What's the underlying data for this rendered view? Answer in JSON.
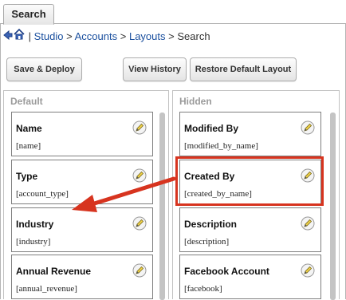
{
  "tabs": [
    {
      "label": "Search"
    }
  ],
  "breadcrumb": {
    "studio": "Studio",
    "accounts": "Accounts",
    "layouts": "Layouts",
    "current": "Search",
    "separator": ">"
  },
  "toolbar": {
    "save_deploy": "Save & Deploy",
    "view_history": "View History",
    "restore_default": "Restore Default Layout"
  },
  "default_panel": {
    "title": "Default",
    "fields": [
      {
        "name": "Name",
        "key": "[name]"
      },
      {
        "name": "Type",
        "key": "[account_type]"
      },
      {
        "name": "Industry",
        "key": "[industry]"
      },
      {
        "name": "Annual Revenue",
        "key": "[annual_revenue]"
      }
    ]
  },
  "hidden_panel": {
    "title": "Hidden",
    "fields": [
      {
        "name": "Modified By",
        "key": "[modified_by_name]"
      },
      {
        "name": "Created By",
        "key": "[created_by_name]"
      },
      {
        "name": "Description",
        "key": "[description]"
      },
      {
        "name": "Facebook Account",
        "key": "[facebook]"
      }
    ]
  },
  "icons": {
    "back": "back-arrow-icon",
    "home": "home-icon",
    "edit": "pencil-icon"
  },
  "colors": {
    "link": "#1a4f9e",
    "highlight": "#d7341f",
    "edit_icon": "#f0d24a"
  }
}
